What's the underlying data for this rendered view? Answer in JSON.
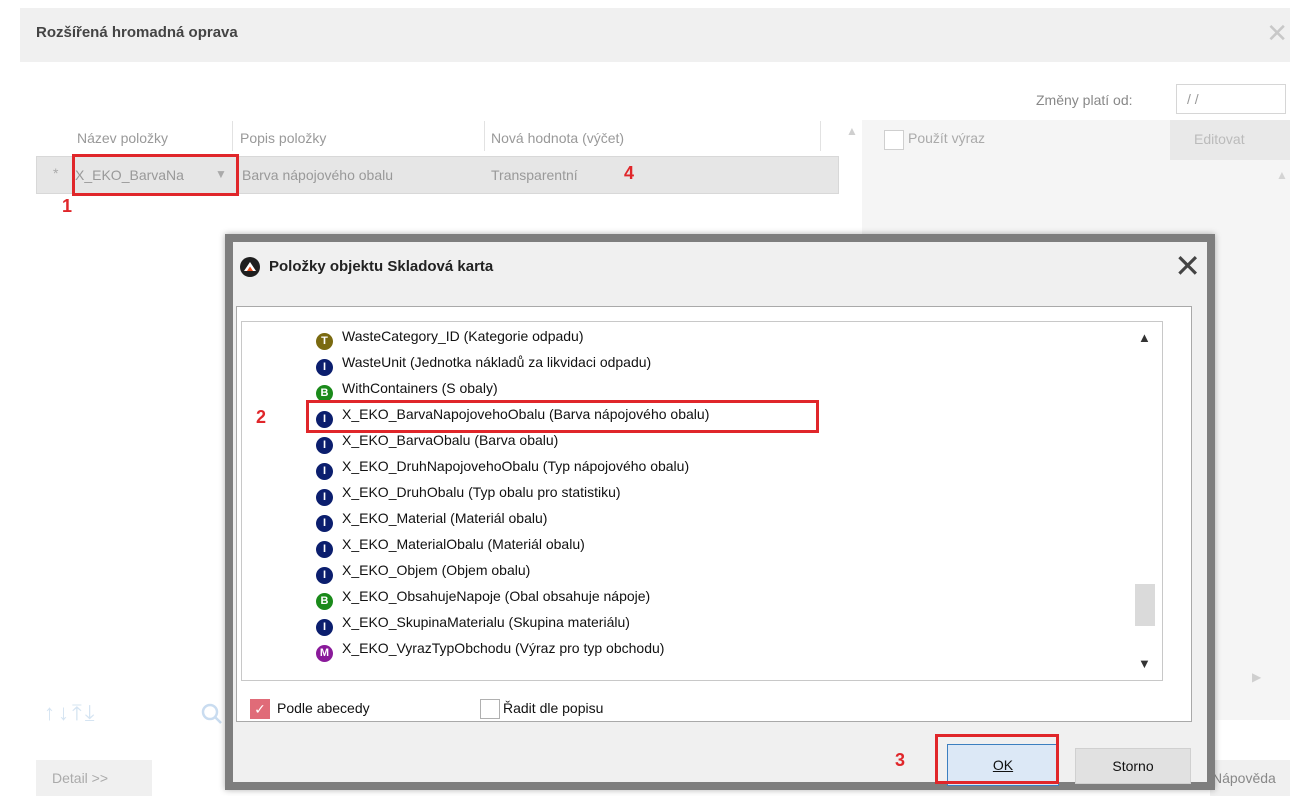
{
  "background": {
    "title": "Rozšířená hromadná oprava",
    "close_glyph": "✕",
    "valid_from": {
      "label": "Změny platí od:",
      "value": "/ /"
    },
    "grid": {
      "columns": [
        "Název položky",
        "Popis položky",
        "Nová hodnota (výčet)"
      ],
      "row": {
        "marker": "*",
        "name": "X_EKO_BarvaNa",
        "description": "Barva nápojového obalu",
        "new_value": "Transparentní"
      }
    },
    "use_expression_label": "Použít výraz",
    "edit_button": "Editovat",
    "move_arrows": "↑↓⤒⤓",
    "detail_button": "Detail >>",
    "help_button": "Nápověda"
  },
  "annotations": [
    "1",
    "2",
    "3",
    "4"
  ],
  "dialog": {
    "title": "Položky objektu Skladová karta",
    "close_glyph": "✕",
    "items": [
      {
        "type": "T",
        "text": "WasteCategory_ID  (Kategorie odpadu)"
      },
      {
        "type": "I",
        "text": "WasteUnit  (Jednotka nákladů za likvidaci odpadu)"
      },
      {
        "type": "B",
        "text": "WithContainers  (S obaly)"
      },
      {
        "type": "I",
        "text": "X_EKO_BarvaNapojovehoObalu  (Barva nápojového obalu)"
      },
      {
        "type": "I",
        "text": "X_EKO_BarvaObalu  (Barva obalu)"
      },
      {
        "type": "I",
        "text": "X_EKO_DruhNapojovehoObalu  (Typ nápojového obalu)"
      },
      {
        "type": "I",
        "text": "X_EKO_DruhObalu  (Typ obalu pro statistiku)"
      },
      {
        "type": "I",
        "text": "X_EKO_Material  (Materiál obalu)"
      },
      {
        "type": "I",
        "text": "X_EKO_MaterialObalu  (Materiál obalu)"
      },
      {
        "type": "I",
        "text": "X_EKO_Objem  (Objem obalu)"
      },
      {
        "type": "B",
        "text": "X_EKO_ObsahujeNapoje  (Obal obsahuje nápoje)"
      },
      {
        "type": "I",
        "text": "X_EKO_SkupinaMaterialu  (Skupina materiálu)"
      },
      {
        "type": "M",
        "text": "X_EKO_VyrazTypObchodu  (Výraz pro typ obchodu)"
      }
    ],
    "sort_alphabetically": {
      "label": "Podle abecedy",
      "checked": true
    },
    "sort_by_description": {
      "label": "Řadit dle popisu",
      "checked": false
    },
    "ok_button": "OK",
    "cancel_button": "Storno"
  },
  "colors": {
    "highlight_red": "#e0262a",
    "badge_T": "#7a6a10",
    "badge_I": "#0b1e6e",
    "badge_B": "#1a8a1a",
    "badge_M": "#8a1a9a",
    "ok_focus": "#3c7fc0"
  }
}
